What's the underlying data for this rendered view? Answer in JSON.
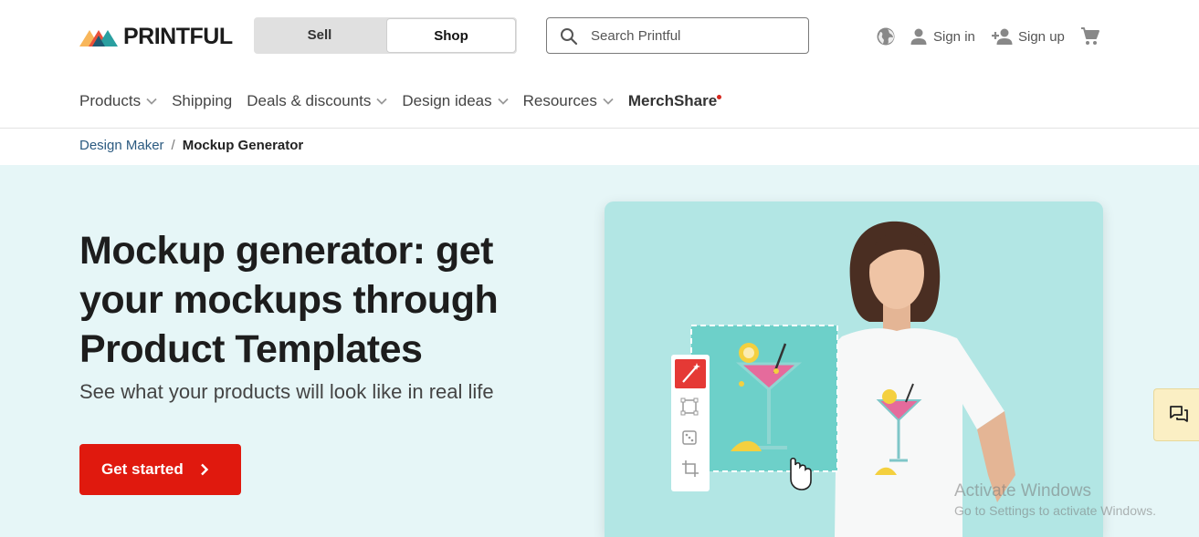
{
  "brand": {
    "name": "PRINTFUL"
  },
  "mode_switch": {
    "sell": "Sell",
    "shop": "Shop",
    "active": "Shop"
  },
  "search": {
    "placeholder": "Search Printful",
    "value": ""
  },
  "account": {
    "sign_in": "Sign in",
    "sign_up": "Sign up"
  },
  "nav": {
    "items": [
      {
        "label": "Products",
        "dropdown": true
      },
      {
        "label": "Shipping",
        "dropdown": false
      },
      {
        "label": "Deals & discounts",
        "dropdown": true
      },
      {
        "label": "Design ideas",
        "dropdown": true
      },
      {
        "label": "Resources",
        "dropdown": true
      },
      {
        "label": "MerchShare",
        "dropdown": false,
        "badge_dot": true
      }
    ]
  },
  "breadcrumb": {
    "parent": "Design Maker",
    "separator": "/",
    "current": "Mockup Generator"
  },
  "hero": {
    "title": "Mockup generator: get your mockups through Product Templates",
    "subtitle": "See what your products will look like in real life",
    "cta_label": "Get started"
  },
  "icons": {
    "search": "search-icon",
    "globe": "globe-icon",
    "user": "user-icon",
    "add_user": "add-user-icon",
    "cart": "cart-icon",
    "chevron": "chevron-down-icon",
    "chat": "chat-icon",
    "magic": "magic-wand-icon",
    "transform": "transform-icon",
    "dice": "dice-icon",
    "crop": "crop-icon",
    "hand": "hand-cursor-icon"
  },
  "watermark": {
    "title": "Activate Windows",
    "subtitle": "Go to Settings to activate Windows."
  },
  "colors": {
    "accent": "#e0190e",
    "hero_bg": "#e6f6f7",
    "visual_bg": "#b2e6e4",
    "link": "#2b5a80"
  }
}
